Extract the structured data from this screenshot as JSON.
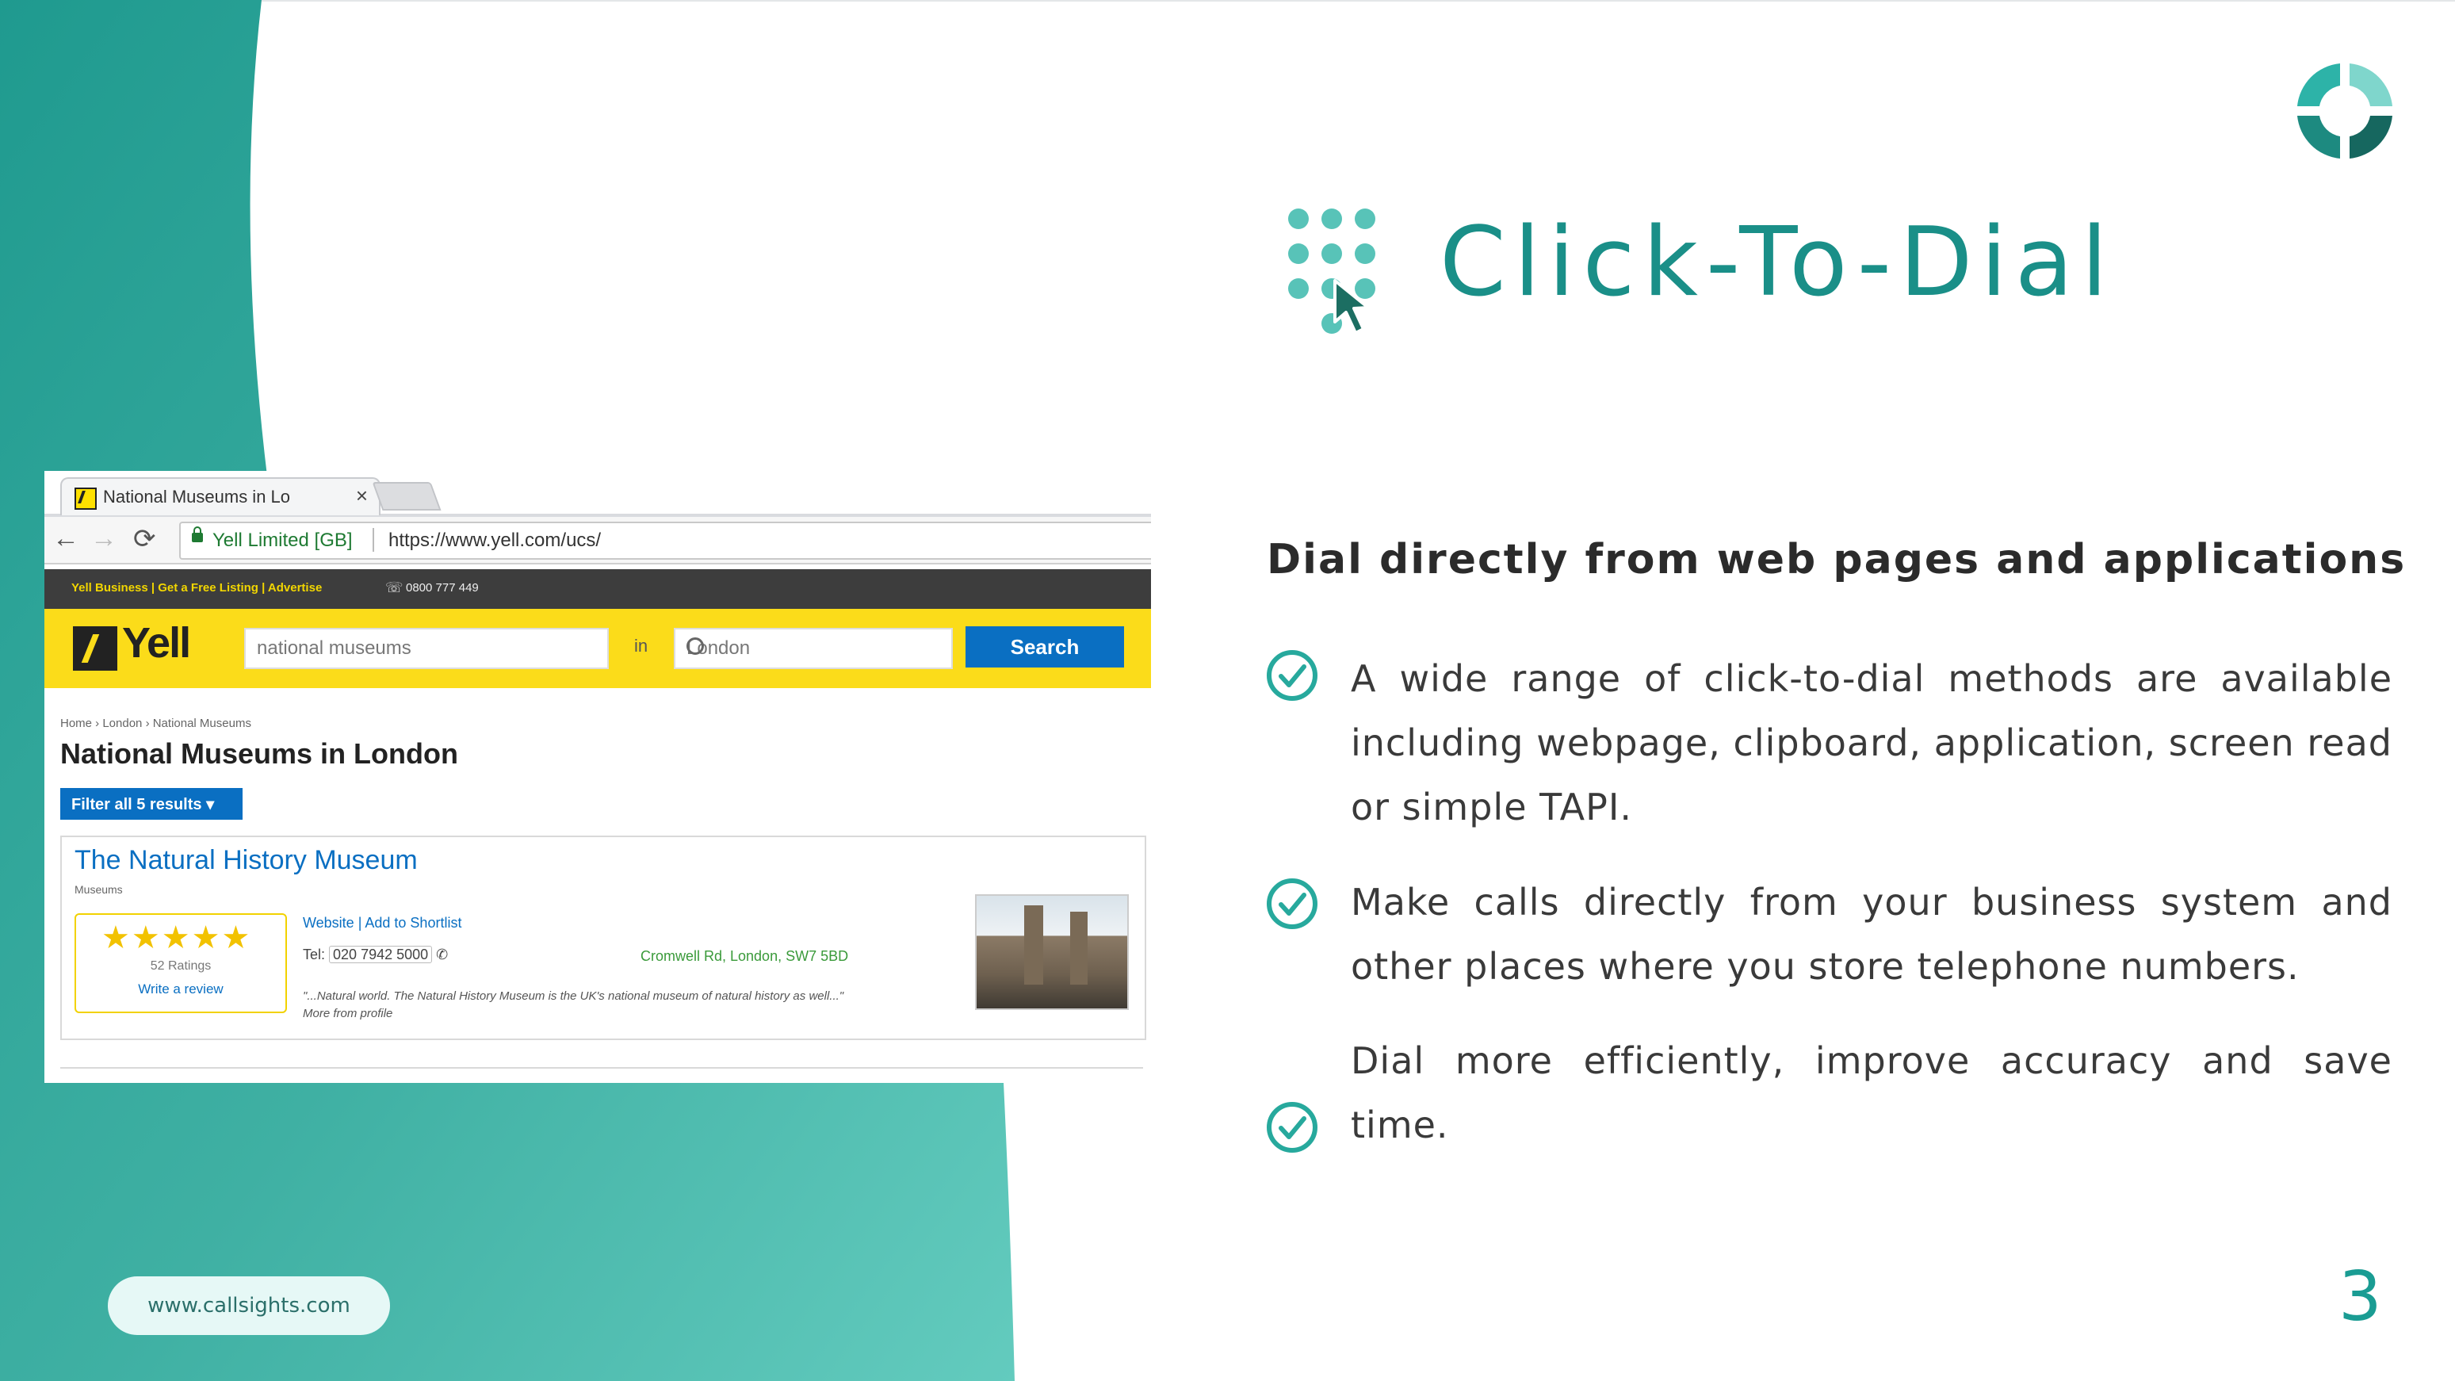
{
  "colors": {
    "teal_dark": "#1a8f88",
    "teal_light": "#58c9bf",
    "yell_yellow": "#fbdc1a",
    "yell_blue": "#0a6fc2"
  },
  "slide": {
    "title": "Click-To-Dial",
    "subtitle": "Dial directly from web pages and applications",
    "bullets": [
      {
        "icon": "check-circle-icon",
        "text": "A wide range of click-to-dial methods are available including webpage, clipboard, application, screen read or simple TAPI."
      },
      {
        "icon": "check-circle-icon",
        "text": "Make calls directly from your business system and other places where you store telephone numbers."
      },
      {
        "icon": "check-circle-icon",
        "text": "Dial more efficiently, improve accuracy and save time."
      }
    ],
    "website": "www.callsights.com",
    "page_number": "3"
  },
  "browser": {
    "tab_title": "National Museums in Lo",
    "tab_close": "×",
    "back_icon": "←",
    "forward_icon": "→",
    "reload_icon": "⟳",
    "site_identity": "Yell Limited [GB]",
    "url": "https://www.yell.com/ucs/"
  },
  "yell": {
    "top_links": "Yell Business | Get a Free Listing | Advertise",
    "phone": "0800 777 449",
    "logo_text": "Yell",
    "search_what": "national museums",
    "in_label": "in",
    "search_where": "London",
    "search_button": "Search",
    "breadcrumb": "Home › London › National Museums",
    "heading": "National Museums in London",
    "filter_button": "Filter all 5 results ▾",
    "result": {
      "name": "The Natural History Museum",
      "category": "Museums",
      "stars": "★★★★★",
      "ratings": "52 Ratings",
      "write_review": "Write a review",
      "links": "Website | Add to Shortlist",
      "tel_label": "Tel:",
      "tel": "020 7942 5000",
      "address": "Cromwell Rd, London, SW7 5BD",
      "quote": "\"...Natural world. The Natural History Museum is the UK's national museum of natural history as well...\"",
      "more": "More from profile"
    }
  }
}
